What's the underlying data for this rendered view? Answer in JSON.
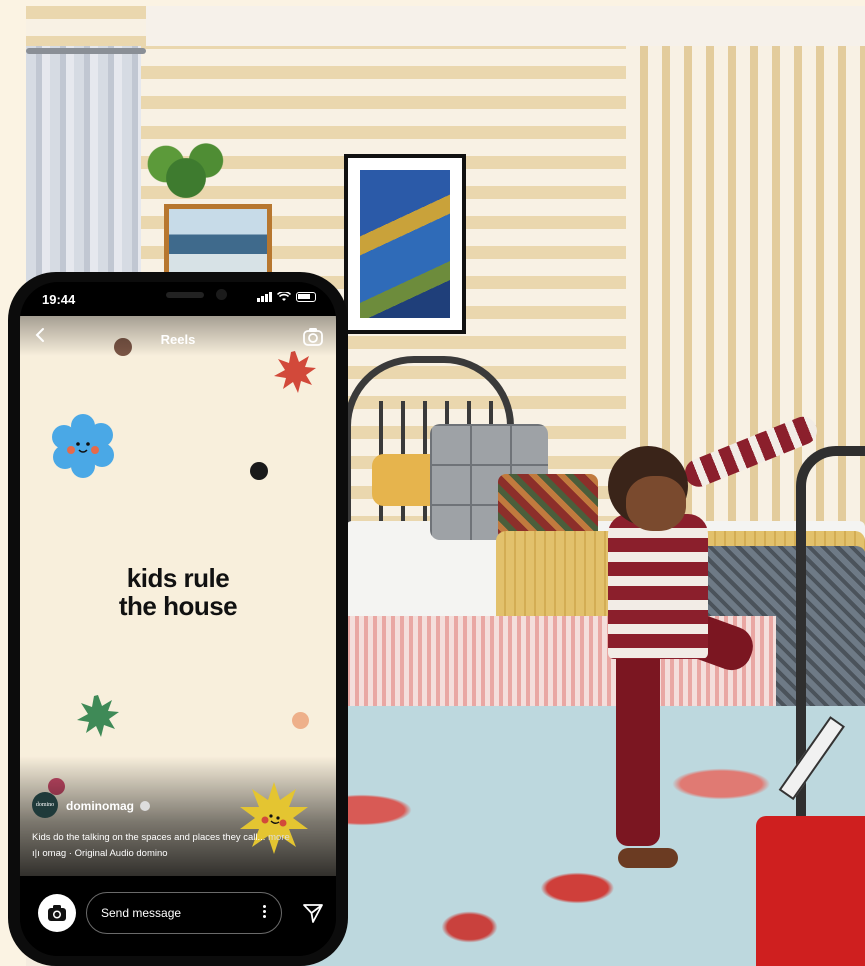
{
  "status_bar": {
    "time": "19:44"
  },
  "reel": {
    "header_title": "Reels",
    "headline_line1": "kids rule",
    "headline_line2": "the house",
    "avatar_text": "domino",
    "username": "dominomag",
    "caption": "Kids do the talking on the spaces and places they call...",
    "caption_more": "more",
    "audio": "omag · Original Audio   domino"
  },
  "bottom_bar": {
    "message_placeholder": "Send message"
  },
  "colors": {
    "reel_background": "#f8efdc",
    "sticker_blue": "#4aa8e6",
    "sticker_red": "#d2493a",
    "sticker_green": "#3f8a57",
    "sticker_yellow": "#e4c531"
  },
  "icons": [
    "back-chevron-icon",
    "camera-icon",
    "send-icon",
    "more-dots-icon",
    "verified-badge-icon",
    "audio-bars-icon"
  ]
}
